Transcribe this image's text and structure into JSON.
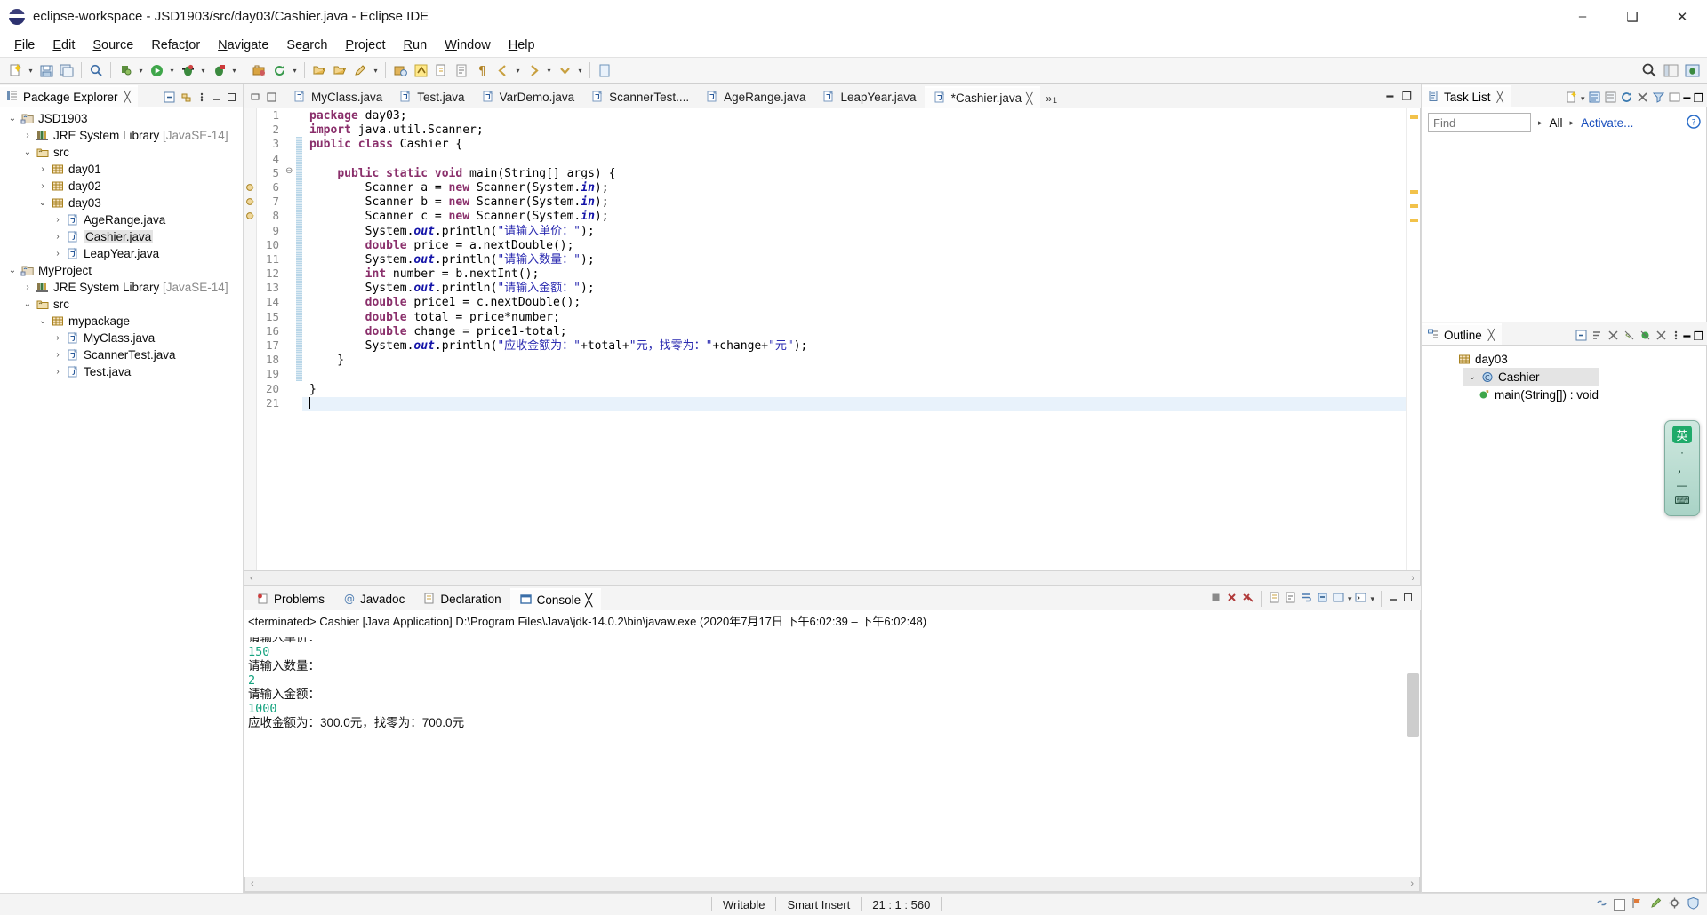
{
  "window": {
    "title": "eclipse-workspace - JSD1903/src/day03/Cashier.java - Eclipse IDE",
    "minimize": "–",
    "maximize": "❑",
    "close": "✕"
  },
  "menu": [
    "File",
    "Edit",
    "Source",
    "Refactor",
    "Navigate",
    "Search",
    "Project",
    "Run",
    "Window",
    "Help"
  ],
  "package_explorer": {
    "tab_label": "Package Explorer",
    "close": "╳",
    "tree": [
      {
        "indent": 0,
        "twisty": "⌄",
        "icon": "java-project-icon",
        "label": "JSD1903",
        "dim": "",
        "selected": false
      },
      {
        "indent": 1,
        "twisty": "›",
        "icon": "jre-library-icon",
        "label": "JRE System Library ",
        "dim": "[JavaSE-14]",
        "selected": false
      },
      {
        "indent": 1,
        "twisty": "⌄",
        "icon": "source-folder-icon",
        "label": "src",
        "dim": "",
        "selected": false
      },
      {
        "indent": 2,
        "twisty": "›",
        "icon": "package-icon",
        "label": "day01",
        "dim": "",
        "selected": false
      },
      {
        "indent": 2,
        "twisty": "›",
        "icon": "package-icon",
        "label": "day02",
        "dim": "",
        "selected": false
      },
      {
        "indent": 2,
        "twisty": "⌄",
        "icon": "package-icon",
        "label": "day03",
        "dim": "",
        "selected": false
      },
      {
        "indent": 3,
        "twisty": "›",
        "icon": "java-file-icon",
        "label": "AgeRange.java",
        "dim": "",
        "selected": false
      },
      {
        "indent": 3,
        "twisty": "›",
        "icon": "java-file-icon",
        "label": "Cashier.java",
        "dim": "",
        "selected": true
      },
      {
        "indent": 3,
        "twisty": "›",
        "icon": "java-file-icon",
        "label": "LeapYear.java",
        "dim": "",
        "selected": false
      },
      {
        "indent": 0,
        "twisty": "⌄",
        "icon": "java-project-icon",
        "label": "MyProject",
        "dim": "",
        "selected": false
      },
      {
        "indent": 1,
        "twisty": "›",
        "icon": "jre-library-icon",
        "label": "JRE System Library ",
        "dim": "[JavaSE-14]",
        "selected": false
      },
      {
        "indent": 1,
        "twisty": "⌄",
        "icon": "source-folder-icon",
        "label": "src",
        "dim": "",
        "selected": false
      },
      {
        "indent": 2,
        "twisty": "⌄",
        "icon": "package-icon",
        "label": "mypackage",
        "dim": "",
        "selected": false
      },
      {
        "indent": 3,
        "twisty": "›",
        "icon": "java-file-icon",
        "label": "MyClass.java",
        "dim": "",
        "selected": false
      },
      {
        "indent": 3,
        "twisty": "›",
        "icon": "java-file-icon",
        "label": "ScannerTest.java",
        "dim": "",
        "selected": false
      },
      {
        "indent": 3,
        "twisty": "›",
        "icon": "java-file-icon",
        "label": "Test.java",
        "dim": "",
        "selected": false
      }
    ]
  },
  "editor": {
    "tabs": [
      {
        "label": "MyClass.java",
        "active": false,
        "dirty": false
      },
      {
        "label": "Test.java",
        "active": false,
        "dirty": false
      },
      {
        "label": "VarDemo.java",
        "active": false,
        "dirty": false
      },
      {
        "label": "ScannerTest....",
        "active": false,
        "dirty": false
      },
      {
        "label": "AgeRange.java",
        "active": false,
        "dirty": false
      },
      {
        "label": "LeapYear.java",
        "active": false,
        "dirty": false
      },
      {
        "label": "*Cashier.java",
        "active": true,
        "dirty": true
      }
    ],
    "overflow_chevron": "»",
    "overflow_count": "1",
    "close": "╳",
    "minimize": "━",
    "maximize": "❐",
    "lines": [
      {
        "n": "1",
        "fold": "",
        "ann": "",
        "html": "<span class=\"kw\">package</span> day03;"
      },
      {
        "n": "2",
        "fold": "",
        "ann": "",
        "html": "<span class=\"kw\">import</span> java.util.Scanner;"
      },
      {
        "n": "3",
        "fold": "",
        "ann": "",
        "html": "<span class=\"kw\">public class</span> Cashier {"
      },
      {
        "n": "4",
        "fold": "",
        "ann": "",
        "html": ""
      },
      {
        "n": "5",
        "fold": "⊖",
        "ann": "",
        "html": "    <span class=\"kw\">public static void</span> main(String[] args) {"
      },
      {
        "n": "6",
        "fold": "",
        "ann": "warning-icon",
        "html": "        Scanner a = <span class=\"kw\">new</span> Scanner(System.<span class=\"fld\">in</span>);"
      },
      {
        "n": "7",
        "fold": "",
        "ann": "warning-icon",
        "html": "        Scanner b = <span class=\"kw\">new</span> Scanner(System.<span class=\"fld\">in</span>);"
      },
      {
        "n": "8",
        "fold": "",
        "ann": "warning-icon",
        "html": "        Scanner c = <span class=\"kw\">new</span> Scanner(System.<span class=\"fld\">in</span>);"
      },
      {
        "n": "9",
        "fold": "",
        "ann": "",
        "html": "        System.<span class=\"fld\">out</span>.println(<span class=\"str\">\"请输入单价：\"</span>);"
      },
      {
        "n": "10",
        "fold": "",
        "ann": "",
        "html": "        <span class=\"kw\">double</span> price = a.nextDouble();"
      },
      {
        "n": "11",
        "fold": "",
        "ann": "",
        "html": "        System.<span class=\"fld\">out</span>.println(<span class=\"str\">\"请输入数量：\"</span>);"
      },
      {
        "n": "12",
        "fold": "",
        "ann": "",
        "html": "        <span class=\"kw\">int</span> number = b.nextInt();"
      },
      {
        "n": "13",
        "fold": "",
        "ann": "",
        "html": "        System.<span class=\"fld\">out</span>.println(<span class=\"str\">\"请输入金额：\"</span>);"
      },
      {
        "n": "14",
        "fold": "",
        "ann": "",
        "html": "        <span class=\"kw\">double</span> price1 = c.nextDouble();"
      },
      {
        "n": "15",
        "fold": "",
        "ann": "",
        "html": "        <span class=\"kw\">double</span> total = price*number;"
      },
      {
        "n": "16",
        "fold": "",
        "ann": "",
        "html": "        <span class=\"kw\">double</span> change = price1-total;"
      },
      {
        "n": "17",
        "fold": "",
        "ann": "",
        "html": "        System.<span class=\"fld\">out</span>.println(<span class=\"str\">\"应收金额为：\"</span>+total+<span class=\"str\">\"元，找零为：\"</span>+change+<span class=\"str\">\"元\"</span>);"
      },
      {
        "n": "18",
        "fold": "",
        "ann": "",
        "html": "    }"
      },
      {
        "n": "19",
        "fold": "",
        "ann": "",
        "html": ""
      },
      {
        "n": "20",
        "fold": "",
        "ann": "",
        "html": "}"
      },
      {
        "n": "21",
        "fold": "",
        "ann": "",
        "html": ""
      }
    ],
    "current_line": 21
  },
  "bottom": {
    "tabs": [
      {
        "label": "Problems",
        "icon": "problems-icon",
        "active": false
      },
      {
        "label": "Javadoc",
        "icon": "javadoc-icon",
        "active": false
      },
      {
        "label": "Declaration",
        "icon": "declaration-icon",
        "active": false
      },
      {
        "label": "Console",
        "icon": "console-icon",
        "active": true
      }
    ],
    "close": "╳",
    "console_header": "<terminated> Cashier [Java Application] D:\\Program Files\\Java\\jdk-14.0.2\\bin\\javaw.exe  (2020年7月17日 下午6:02:39 – 下午6:02:48)",
    "console_lines": [
      {
        "text": "请输入单价：",
        "kind": "out",
        "clipped": true
      },
      {
        "text": "150",
        "kind": "in",
        "clipped": false
      },
      {
        "text": "请输入数量：",
        "kind": "out",
        "clipped": false
      },
      {
        "text": "2",
        "kind": "in",
        "clipped": false
      },
      {
        "text": "请输入金额：",
        "kind": "out",
        "clipped": false
      },
      {
        "text": "1000",
        "kind": "in",
        "clipped": false
      },
      {
        "text": "应收金额为：300.0元，找零为：700.0元",
        "kind": "out",
        "clipped": false
      }
    ],
    "scroll_left": "‹",
    "scroll_right": "›"
  },
  "task_list": {
    "tab_label": "Task List",
    "close": "╳",
    "find_placeholder": "Find",
    "find_value": "",
    "all_label": "All",
    "activate_label": "Activate...",
    "help_icon": "?",
    "minimize": "━",
    "maximize": "❐"
  },
  "outline": {
    "tab_label": "Outline",
    "close": "╳",
    "items": [
      {
        "indent": 0,
        "twisty": "",
        "icon": "package-icon",
        "label": "day03",
        "selected": false
      },
      {
        "indent": 0,
        "twisty": "⌄",
        "icon": "class-icon",
        "label": "Cashier",
        "selected": true
      },
      {
        "indent": 1,
        "twisty": "",
        "icon": "method-icon",
        "label": "main(String[]) : void",
        "selected": false
      }
    ],
    "minimize": "━",
    "maximize": "❐"
  },
  "ime": {
    "lang": "英",
    "dot": "·",
    "comma": "，",
    "dash": "—",
    "keyboard": "⌨"
  },
  "status": {
    "writable": "Writable",
    "insert_mode": "Smart Insert",
    "position": "21 : 1 : 560"
  },
  "colors": {
    "keyword": "#8a2f6b",
    "string": "#2a2ab0",
    "field": "#1414a8",
    "console_input": "#15a37f",
    "tree_dim": "#8a8a8a",
    "link": "#1a4fbd",
    "selection": "#e4e4e4",
    "current_line": "#e8f2fb"
  }
}
